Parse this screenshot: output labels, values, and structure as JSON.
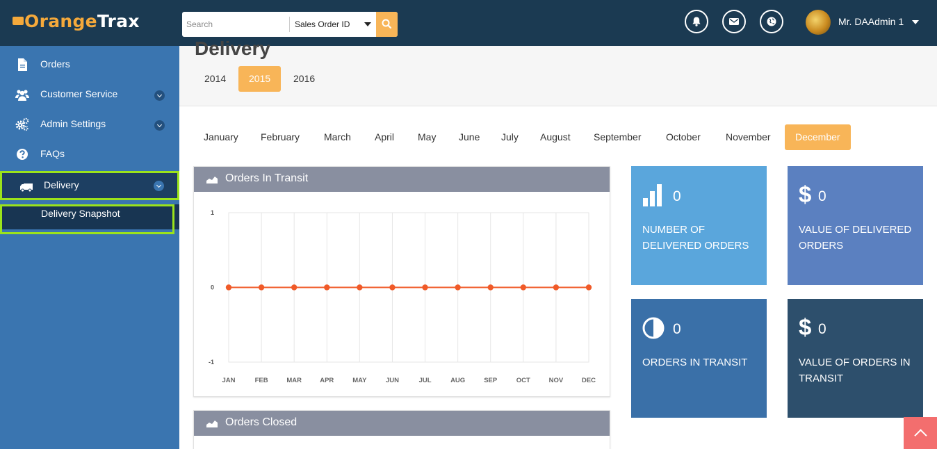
{
  "brand": {
    "name_a": "range",
    "name_b": "Trax",
    "logo_letter": "O"
  },
  "search": {
    "placeholder": "Search",
    "field": "Sales Order ID"
  },
  "user": {
    "name": "Mr. DAAdmin 1"
  },
  "sidebar": {
    "items": [
      {
        "label": "Orders",
        "icon": "document-icon"
      },
      {
        "label": "Customer Service",
        "icon": "users-icon",
        "expandable": true
      },
      {
        "label": "Admin Settings",
        "icon": "gears-icon",
        "expandable": true
      },
      {
        "label": "FAQs",
        "icon": "question-circle-icon"
      },
      {
        "label": "Delivery",
        "icon": "truck-icon",
        "expandable": true,
        "active": true
      }
    ],
    "submenu": [
      {
        "label": "Delivery Snapshot",
        "active": true
      }
    ]
  },
  "page": {
    "title": "Delivery"
  },
  "years": {
    "items": [
      "2014",
      "2015",
      "2016"
    ],
    "selected": "2015"
  },
  "months": {
    "items": [
      "January",
      "February",
      "March",
      "April",
      "May",
      "June",
      "July",
      "August",
      "September",
      "October",
      "November",
      "December"
    ],
    "selected": "December"
  },
  "panels": {
    "transit": {
      "title": "Orders In Transit"
    },
    "closed": {
      "title": "Orders Closed"
    }
  },
  "stats": [
    {
      "value": "0",
      "label": "NUMBER OF DELIVERED ORDERS",
      "icon": "bar-chart-icon",
      "color": "#5aa6dc"
    },
    {
      "value": "0",
      "label": "VALUE OF DELIVERED ORDERS",
      "icon": "dollar-icon",
      "color": "#5b80c0"
    },
    {
      "value": "0",
      "label": "ORDERS IN TRANSIT",
      "icon": "half-circle-icon",
      "color": "#3a70a8"
    },
    {
      "value": "0",
      "label": "VALUE OF ORDERS IN TRANSIT",
      "icon": "dollar-icon",
      "color": "#2d4f6c"
    }
  ],
  "colors": {
    "accent": "#f8b558",
    "highlight": "#9be31b",
    "line": "#f05a28"
  },
  "chart_data": {
    "type": "line",
    "title": "Orders In Transit",
    "categories": [
      "JAN",
      "FEB",
      "MAR",
      "APR",
      "MAY",
      "JUN",
      "JUL",
      "AUG",
      "SEP",
      "OCT",
      "NOV",
      "DEC"
    ],
    "series": [
      {
        "values": [
          0,
          0,
          0,
          0,
          0,
          0,
          0,
          0,
          0,
          0,
          0,
          0
        ]
      }
    ],
    "ylim": [
      -1,
      1
    ],
    "yticks": [
      "1",
      "0",
      "-1"
    ],
    "grid": true
  }
}
